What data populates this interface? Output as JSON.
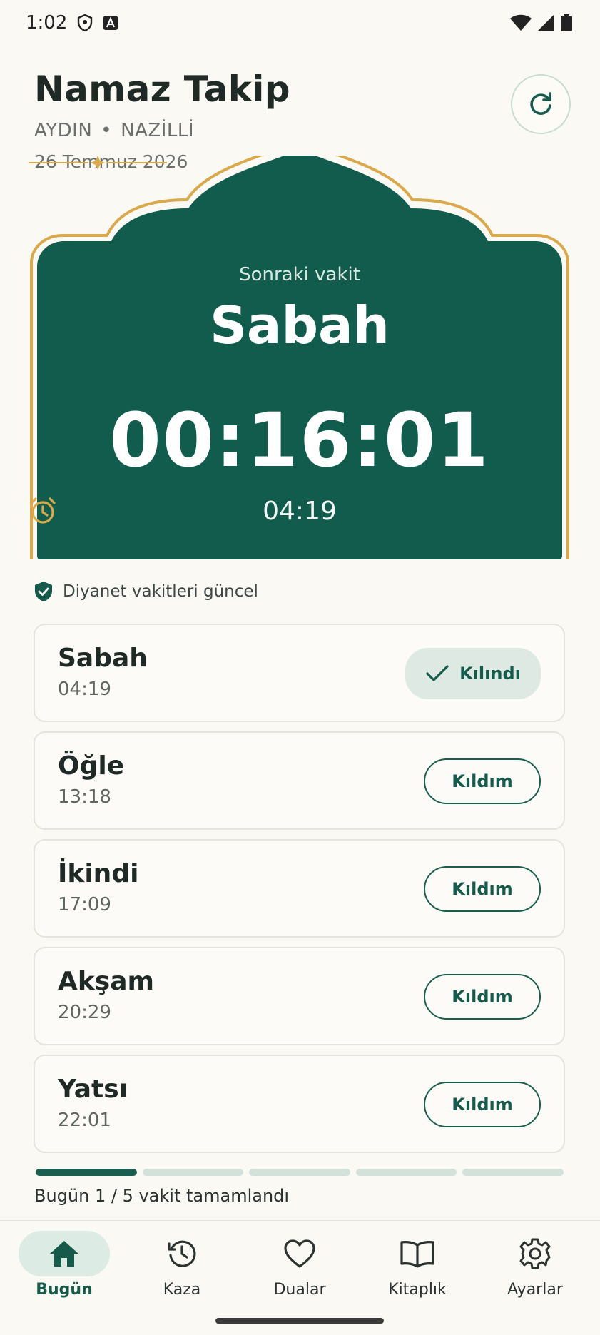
{
  "status_bar": {
    "time": "1:02"
  },
  "header": {
    "title": "Namaz Takip",
    "city": "AYDIN",
    "district": "NAZİLLİ",
    "separator": "•",
    "date": "26 Temmuz 2026"
  },
  "hero": {
    "label": "Sonraki vakit",
    "prayer": "Sabah",
    "countdown": "00:16:01",
    "time": "04:19"
  },
  "verify": {
    "text": "Diyanet vakitleri güncel"
  },
  "prayers": [
    {
      "name": "Sabah",
      "time": "04:19",
      "button": "Kılındı",
      "done": true
    },
    {
      "name": "Öğle",
      "time": "13:18",
      "button": "Kıldım",
      "done": false
    },
    {
      "name": "İkindi",
      "time": "17:09",
      "button": "Kıldım",
      "done": false
    },
    {
      "name": "Akşam",
      "time": "20:29",
      "button": "Kıldım",
      "done": false
    },
    {
      "name": "Yatsı",
      "time": "22:01",
      "button": "Kıldım",
      "done": false
    }
  ],
  "progress": {
    "completed": 1,
    "total": 5,
    "text": "Bugün 1 / 5 vakit tamamlandı"
  },
  "nav": [
    {
      "label": "Bugün",
      "icon": "home-icon",
      "active": true
    },
    {
      "label": "Kaza",
      "icon": "history-clock-icon",
      "active": false
    },
    {
      "label": "Dualar",
      "icon": "heart-icon",
      "active": false
    },
    {
      "label": "Kitaplık",
      "icon": "book-icon",
      "active": false
    },
    {
      "label": "Ayarlar",
      "icon": "gear-icon",
      "active": false
    }
  ],
  "colors": {
    "primary": "#155a4b",
    "accent_gold": "#d9a94c",
    "background": "#fbf9f3",
    "done_bg": "#dde9e2"
  }
}
